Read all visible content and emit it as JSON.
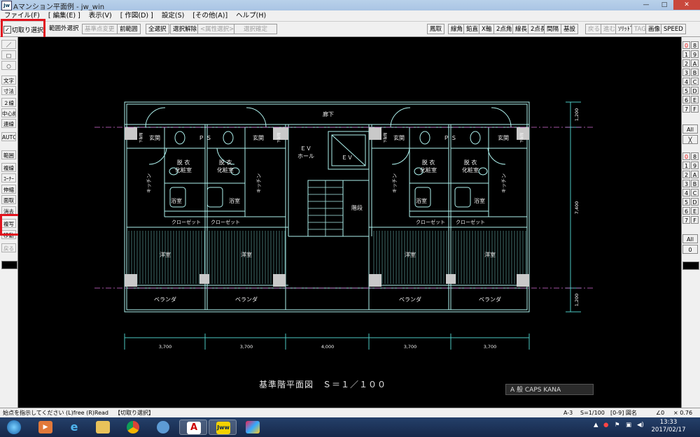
{
  "window": {
    "app_icon": "Jw",
    "title": "Aマンション平面例 - jw_win",
    "minimize": "—",
    "maximize": "□",
    "close": "✕"
  },
  "menu": [
    "ファイル(F)",
    "[ 編集(E) ]",
    "表示(V)",
    "[ 作図(D) ]",
    "設定(S)",
    "[その他(A)]",
    "ヘルプ(H)"
  ],
  "toolbar": {
    "checkbox_mark": "✓",
    "checkbox_label": "切取り選択",
    "outside_select": "範囲外選択",
    "base_point_change": "基準点変更",
    "prev_range": "前範囲",
    "select_all": "全選択",
    "deselect": "選択解除",
    "attr_select": "<属性選択>",
    "confirm_select": "選択確定",
    "right_buttons": [
      "鳳取",
      "線角",
      "鉛直",
      "X軸",
      "2点角",
      "線長",
      "2点長",
      "間隔",
      "基設"
    ],
    "nav_buttons": [
      "戻る",
      "進む",
      "ｿﾘｯﾄﾞ",
      "TAG",
      "画像",
      "SPEED"
    ]
  },
  "left_tools": [
    "／",
    "□",
    "○",
    "文字",
    "寸法",
    "２線",
    "中心線",
    "連線",
    "AUTO",
    "範囲",
    "複線",
    "ｺｰﾅｰ",
    "伸縮",
    "面取",
    "消去",
    "複写",
    "移動",
    "戻る"
  ],
  "right_layers": {
    "rows": [
      [
        "0",
        "8"
      ],
      [
        "1",
        "9"
      ],
      [
        "2",
        "A"
      ],
      [
        "3",
        "B"
      ],
      [
        "4",
        "C"
      ],
      [
        "5",
        "D"
      ],
      [
        "6",
        "E"
      ],
      [
        "7",
        "F"
      ]
    ],
    "all": "All",
    "x": "╳",
    "rows2": [
      [
        "0",
        "8"
      ],
      [
        "1",
        "9"
      ],
      [
        "2",
        "A"
      ],
      [
        "3",
        "B"
      ],
      [
        "4",
        "C"
      ],
      [
        "5",
        "D"
      ],
      [
        "6",
        "E"
      ],
      [
        "7",
        "F"
      ]
    ],
    "all2": "All",
    "zero": "0"
  },
  "plan": {
    "corridor": "廊下",
    "ev_hall_1": "ＥＶ",
    "ev_hall_2": "ホール",
    "ev": "ＥＶ",
    "stairs": "階段",
    "entrance": "玄関",
    "ps": "Ｐ Ｓ",
    "toilet": "トイレ",
    "laundry_1": "脱 衣",
    "laundry_2": "化粧室",
    "kitchen": "キッチン",
    "bath": "浴室",
    "closet": "クローゼット",
    "western_room": "洋室",
    "veranda": "ベランダ",
    "dims_bottom": [
      "3,700",
      "3,700",
      "4,000",
      "3,700",
      "3,700"
    ],
    "dims_right": [
      "1,200",
      "7,400",
      "1,200"
    ],
    "shoe": "下駄箱"
  },
  "caption": "基準階平面図　Ｓ＝１／１００",
  "ime": "A 般 CAPS KANA",
  "status": {
    "message": "始点を指示してください (L)free (R)Read",
    "mode": "【切取り選択】",
    "layer": "A-3",
    "scale": "S=1/100",
    "layer_group": "[0-9] 図名",
    "angle": "∠0",
    "zoom": "× 0.76"
  },
  "taskbar": {
    "apps": [
      "start",
      "media-player",
      "internet-explorer",
      "file-explorer",
      "chrome",
      "mail",
      "acrobat",
      "jw-cad",
      "paint"
    ],
    "time": "13:33",
    "date": "2017/02/17"
  }
}
